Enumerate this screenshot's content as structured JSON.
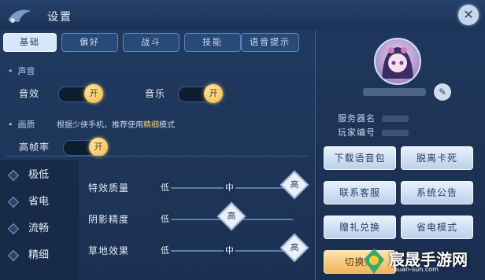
{
  "window": {
    "title": "设置"
  },
  "tabs": [
    {
      "label": "基础",
      "active": true
    },
    {
      "label": "偏好",
      "active": false
    },
    {
      "label": "战斗",
      "active": false
    },
    {
      "label": "技能",
      "active": false
    },
    {
      "label": "语音提示",
      "active": false
    }
  ],
  "sound": {
    "section_label": "声音",
    "effect_label": "音效",
    "effect_toggle": "开",
    "music_label": "音乐",
    "music_toggle": "开"
  },
  "quality": {
    "section_label": "画质",
    "note_prefix": "根据少侠手机，推荐使用",
    "note_highlight": "精细",
    "note_suffix": "模式",
    "high_fps_label": "高帧率",
    "high_fps_toggle": "开"
  },
  "presets": [
    "极低",
    "省电",
    "流畅",
    "精细"
  ],
  "sliders": [
    {
      "label": "特效质量",
      "min": "低",
      "mid": "中",
      "max": "高",
      "level": 1.0
    },
    {
      "label": "阴影精度",
      "min": "低",
      "max": "高",
      "level": 0.5
    },
    {
      "label": "草地效果",
      "min": "低",
      "mid": "中",
      "max": "高",
      "level": 1.0
    }
  ],
  "profile": {
    "server_label": "服务器名",
    "player_id_label": "玩家编号"
  },
  "buttons": {
    "download_voice": "下载语音包",
    "unstuck": "脱离卡死",
    "contact_service": "联系客服",
    "announcement": "系统公告",
    "gift_redeem": "赠礼兑换",
    "power_saving": "省电模式",
    "switch_account": "切换账"
  },
  "watermark": {
    "text": "宸晟手游网",
    "sub": "huan-sun.com"
  },
  "colors": {
    "accent_orange": "#f2b33c",
    "panel": "#213a60",
    "button_light": "#e8f1fc"
  }
}
